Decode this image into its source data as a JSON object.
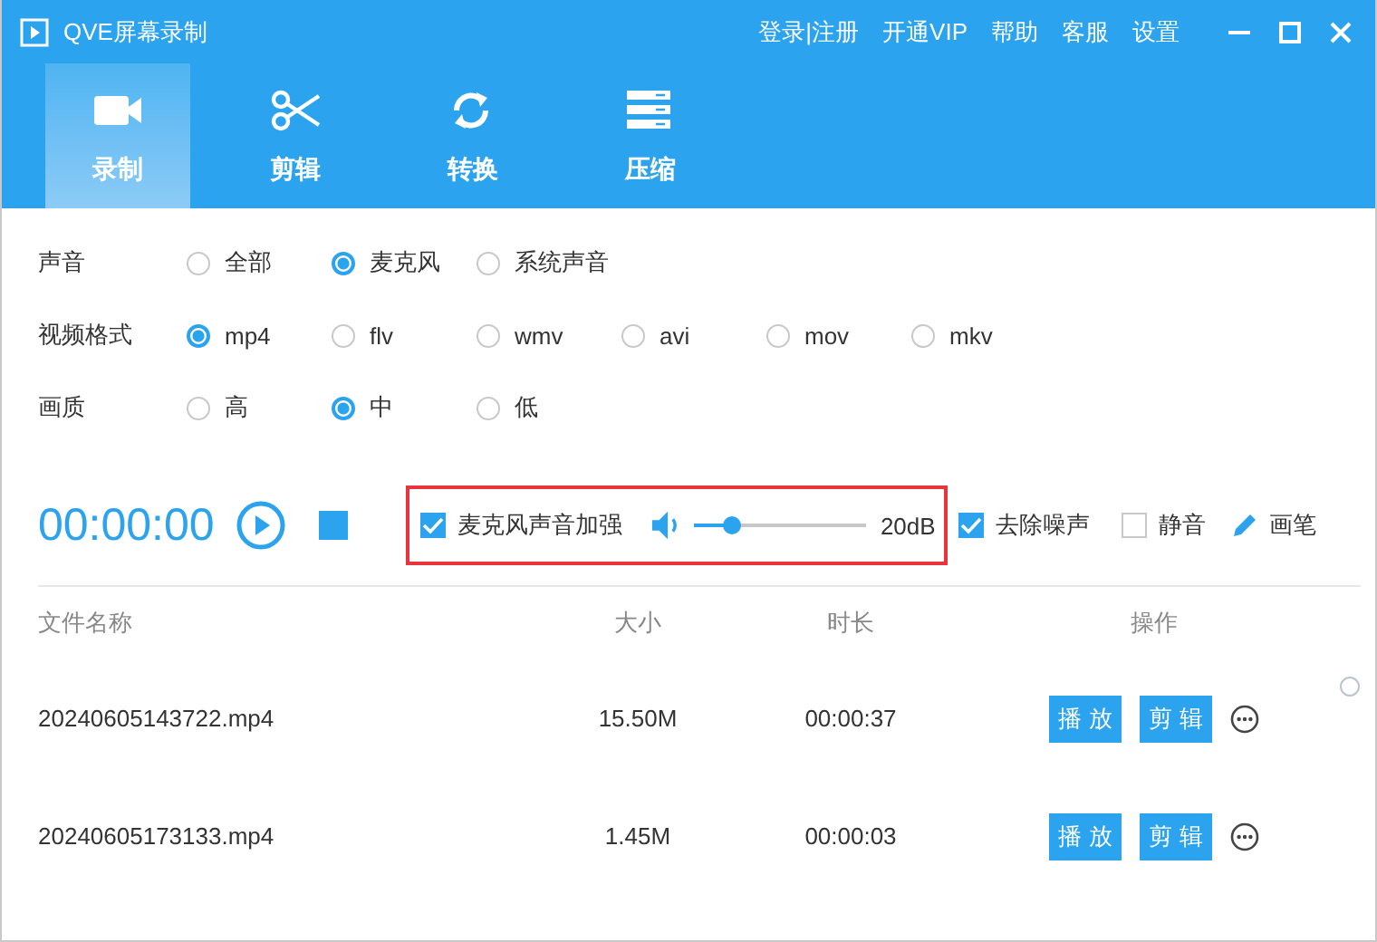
{
  "window": {
    "title": "QVE屏幕录制"
  },
  "nav_links": [
    "登录|注册",
    "开通VIP",
    "帮助",
    "客服",
    "设置"
  ],
  "tabs": [
    {
      "label": "录制",
      "kind": "video",
      "selected": true
    },
    {
      "label": "剪辑",
      "kind": "scissors",
      "selected": false
    },
    {
      "label": "转换",
      "kind": "convert",
      "selected": false
    },
    {
      "label": "压缩",
      "kind": "compress",
      "selected": false
    }
  ],
  "option_groups": [
    {
      "label": "声音",
      "options": [
        {
          "label": "全部",
          "selected": false
        },
        {
          "label": "麦克风",
          "selected": true
        },
        {
          "label": "系统声音",
          "selected": false
        }
      ]
    },
    {
      "label": "视频格式",
      "options": [
        {
          "label": "mp4",
          "selected": true
        },
        {
          "label": "flv",
          "selected": false
        },
        {
          "label": "wmv",
          "selected": false
        },
        {
          "label": "avi",
          "selected": false
        },
        {
          "label": "mov",
          "selected": false
        },
        {
          "label": "mkv",
          "selected": false
        }
      ]
    },
    {
      "label": "画质",
      "options": [
        {
          "label": "高",
          "selected": false
        },
        {
          "label": "中",
          "selected": true
        },
        {
          "label": "低",
          "selected": false
        }
      ]
    }
  ],
  "recorder": {
    "time": "00:00:00",
    "mic_boost": {
      "label": "麦克风声音加强",
      "checked": true
    },
    "volume": {
      "level": 0.23,
      "reading": "20dB"
    },
    "denoise": {
      "label": "去除噪声",
      "checked": true
    },
    "mute": {
      "label": "静音",
      "checked": false
    },
    "pen": {
      "label": "画笔"
    }
  },
  "table": {
    "columns": [
      "文件名称",
      "大小",
      "时长",
      "操作"
    ],
    "rows": [
      {
        "name": "20240605143722.mp4",
        "size": "15.50M",
        "duration": "00:00:37",
        "actions": [
          "播 放",
          "剪 辑"
        ]
      },
      {
        "name": "20240605173133.mp4",
        "size": "1.45M",
        "duration": "00:00:03",
        "actions": [
          "播 放",
          "剪 辑"
        ]
      }
    ]
  }
}
